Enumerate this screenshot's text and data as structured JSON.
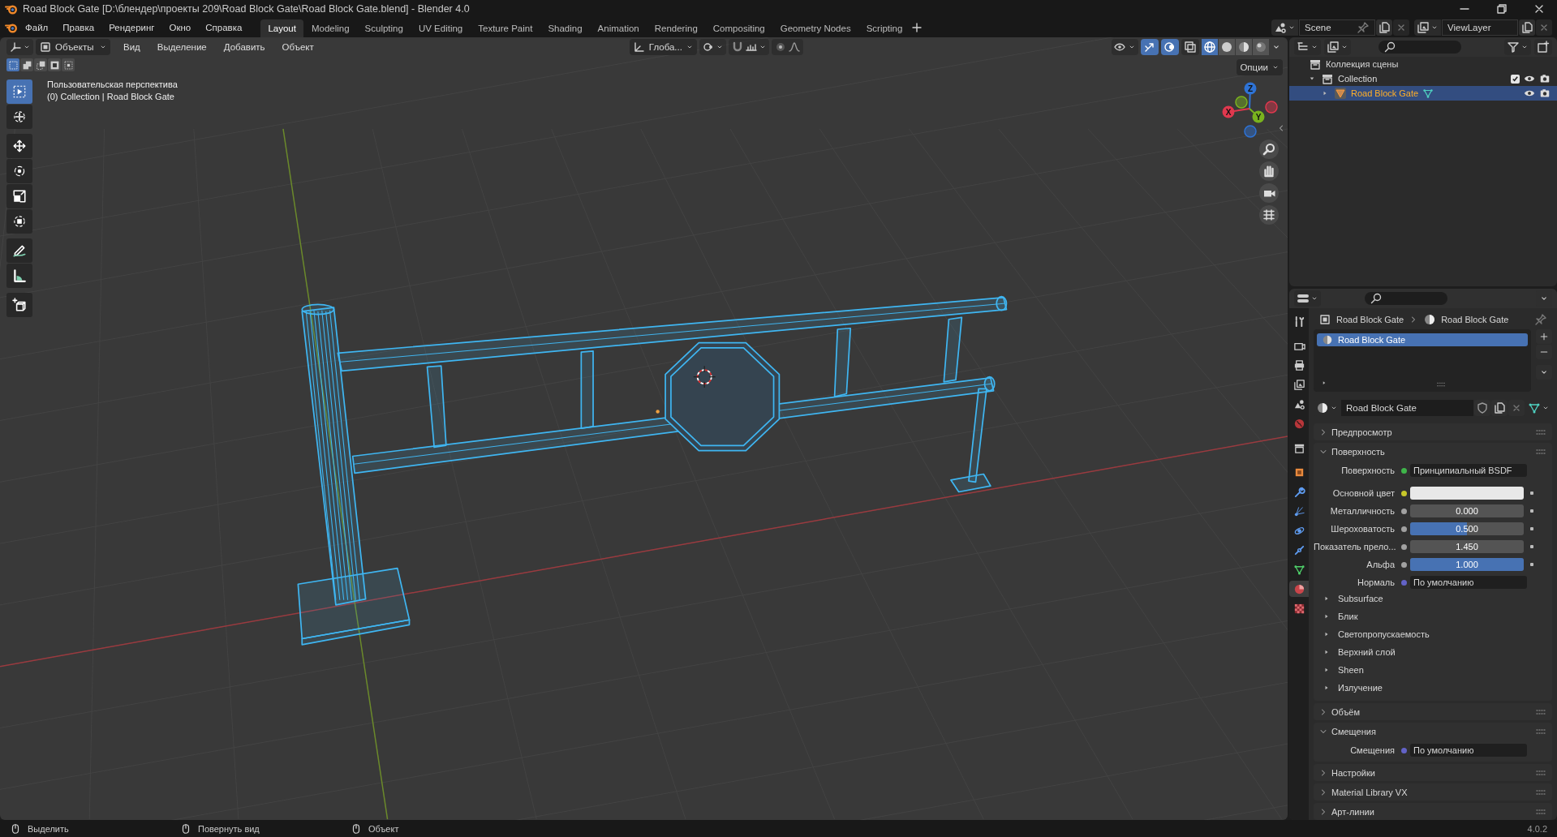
{
  "window": {
    "title": "Road Block Gate [D:\\блендер\\проекты 209\\Road Block Gate\\Road Block Gate.blend] - Blender 4.0"
  },
  "menu": [
    "Файл",
    "Правка",
    "Рендеринг",
    "Окно",
    "Справка"
  ],
  "workspaces": [
    {
      "label": "Layout",
      "selected": true
    },
    {
      "label": "Modeling",
      "selected": false
    },
    {
      "label": "Sculpting",
      "selected": false
    },
    {
      "label": "UV Editing",
      "selected": false
    },
    {
      "label": "Texture Paint",
      "selected": false
    },
    {
      "label": "Shading",
      "selected": false
    },
    {
      "label": "Animation",
      "selected": false
    },
    {
      "label": "Rendering",
      "selected": false
    },
    {
      "label": "Compositing",
      "selected": false
    },
    {
      "label": "Geometry Nodes",
      "selected": false
    },
    {
      "label": "Scripting",
      "selected": false
    }
  ],
  "scene": {
    "scene": "Scene",
    "view_layer": "ViewLayer"
  },
  "viewport_header": {
    "mode": "Объекты",
    "menus": [
      "Вид",
      "Выделение",
      "Добавить",
      "Объект"
    ],
    "orientation": "Глоба...",
    "options": "Опции"
  },
  "viewport_toggles": [
    {
      "kind": "gizmo",
      "selected": true
    },
    {
      "kind": "overlay",
      "selected": true
    },
    {
      "kind": "xray",
      "selected": false
    }
  ],
  "shading": [
    {
      "kind": "wire",
      "selected": true
    },
    {
      "kind": "solid",
      "selected": false
    },
    {
      "kind": "matprev",
      "selected": false
    },
    {
      "kind": "rendered",
      "selected": false
    }
  ],
  "select_modes": [
    {
      "kind": "sel_new",
      "selected": true
    },
    {
      "kind": "sel_ext",
      "selected": false
    },
    {
      "kind": "sel_sub",
      "selected": false
    },
    {
      "kind": "sel_xor",
      "selected": false
    },
    {
      "kind": "sel_and",
      "selected": false
    }
  ],
  "tools": [
    [
      {
        "kind": "select",
        "selected": true
      },
      {
        "kind": "cursor",
        "selected": false
      }
    ],
    [
      {
        "kind": "move",
        "selected": false
      },
      {
        "kind": "rotate",
        "selected": false
      },
      {
        "kind": "scale",
        "selected": false
      },
      {
        "kind": "transform",
        "selected": false
      }
    ],
    [
      {
        "kind": "annotate",
        "selected": false
      },
      {
        "kind": "measure",
        "selected": false
      }
    ],
    [
      {
        "kind": "add_cube",
        "selected": false
      }
    ]
  ],
  "viewport_info": [
    "Пользовательская перспектива",
    "(0) Collection | Road Block Gate"
  ],
  "axis_gizmo": [
    {
      "label": "Z",
      "color": "#2e73d6"
    },
    {
      "label": "Y",
      "color": "#7ab31e"
    },
    {
      "label": "X",
      "color": "#e0384e"
    }
  ],
  "outliner": {
    "root": "Коллекция сцены",
    "items": [
      {
        "name": "Collection",
        "expanded": true,
        "checked": true,
        "selected": false,
        "children": [
          {
            "name": "Road Block Gate",
            "expanded": false,
            "selected": true
          }
        ]
      }
    ]
  },
  "properties": {
    "tabs": [
      {
        "kind": "tool",
        "selected": false
      },
      {
        "kind": "render",
        "selected": false
      },
      {
        "kind": "output",
        "selected": false
      },
      {
        "kind": "view_layer",
        "selected": false
      },
      {
        "kind": "scene",
        "selected": false
      },
      {
        "kind": "world",
        "selected": false
      },
      {
        "kind": "collection",
        "selected": false
      },
      {
        "kind": "object",
        "selected": false
      },
      {
        "kind": "modifiers",
        "selected": false
      },
      {
        "kind": "particles",
        "selected": false
      },
      {
        "kind": "physics",
        "selected": false
      },
      {
        "kind": "constraints",
        "selected": false
      },
      {
        "kind": "data",
        "selected": false
      },
      {
        "kind": "material",
        "selected": true
      },
      {
        "kind": "texture",
        "selected": false
      }
    ],
    "breadcrumb": [
      "Road Block Gate",
      "Road Block Gate"
    ],
    "material_slots": [
      {
        "name": "Road Block Gate",
        "selected": true
      }
    ],
    "material": "Road Block Gate",
    "panels": [
      {
        "title": "Предпросмотр",
        "expanded": false
      },
      {
        "title": "Поверхность",
        "expanded": true,
        "fields": [
          {
            "label": "Поверхность",
            "kind": "link",
            "value": "Принципиальный BSDF",
            "color": "#3fb54a"
          },
          {
            "label": "Основной цвет",
            "kind": "color",
            "color": "#c7c729",
            "swatch": {
              "color": "#e8e8e8"
            }
          },
          {
            "label": "Металличность",
            "kind": "slider",
            "value": "0.000",
            "level": 0,
            "color": "#a1a1a1"
          },
          {
            "label": "Шероховатость",
            "kind": "slider",
            "value": "0.500",
            "level": 0.5,
            "color": "#a1a1a1"
          },
          {
            "label": "Показатель прело...",
            "kind": "number",
            "value": "1.450",
            "color": "#a1a1a1"
          },
          {
            "label": "Альфа",
            "kind": "slider",
            "value": "1.000",
            "level": 1,
            "color": "#a1a1a1"
          },
          {
            "label": "Нормаль",
            "kind": "link",
            "value": "По умолчанию",
            "color": "#6363c7"
          }
        ],
        "subpanels": [
          {
            "title": "Subsurface",
            "expanded": false
          },
          {
            "title": "Блик",
            "expanded": false
          },
          {
            "title": "Светопропускаемость",
            "expanded": false
          },
          {
            "title": "Верхний слой",
            "expanded": false
          },
          {
            "title": "Sheen",
            "expanded": false
          },
          {
            "title": "Излучение",
            "expanded": false
          }
        ]
      },
      {
        "title": "Объём",
        "expanded": false
      },
      {
        "title": "Смещения",
        "expanded": true,
        "fields": [
          {
            "label": "Смещения",
            "kind": "link",
            "value": "По умолчанию",
            "color": "#6363c7"
          }
        ]
      },
      {
        "title": "Настройки",
        "expanded": false
      },
      {
        "title": "Material Library VX",
        "expanded": false
      },
      {
        "title": "Арт-линии",
        "expanded": false
      }
    ]
  },
  "status_bar": {
    "hints": [
      "Выделить",
      "Повернуть вид",
      "Объект"
    ],
    "version": "4.0.2"
  }
}
